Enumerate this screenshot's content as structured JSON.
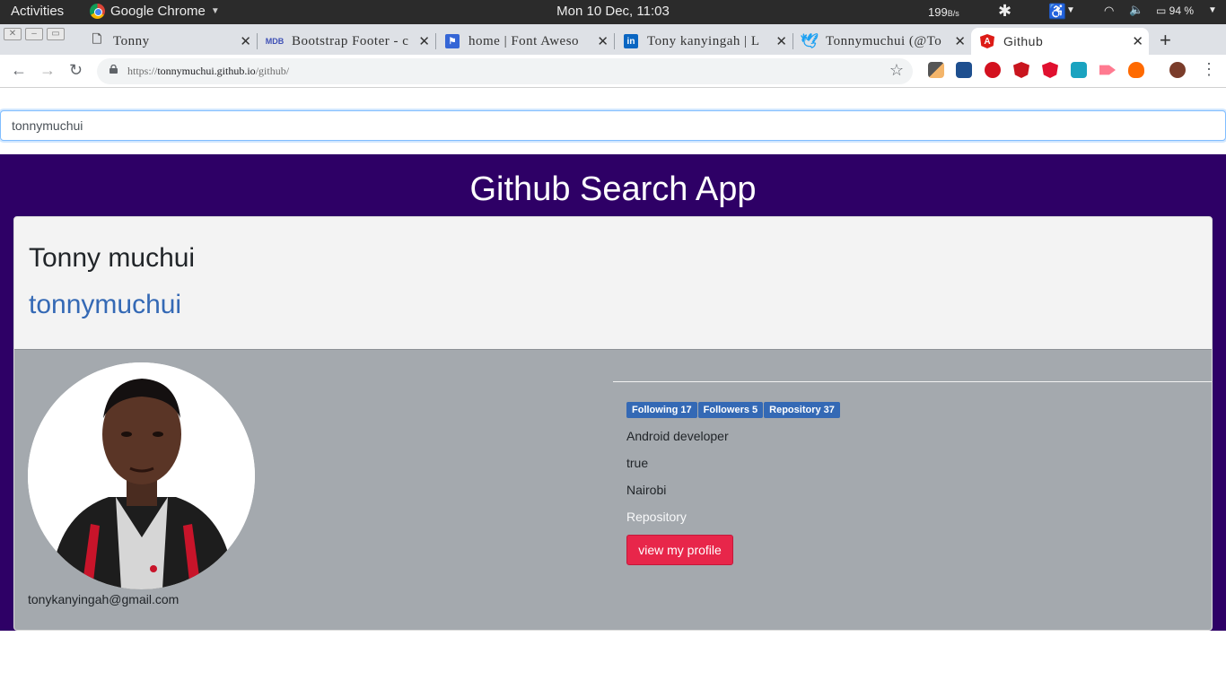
{
  "system_bar": {
    "activities": "Activities",
    "app_name": "Google Chrome",
    "clock": "Mon 10 Dec, 11:03",
    "net_speed": "199",
    "net_unit": "B/s",
    "battery": "94 %"
  },
  "tabs": [
    {
      "title": "Tonny",
      "icon": "page-icon"
    },
    {
      "title": "Bootstrap Footer - c",
      "icon": "mdb-icon"
    },
    {
      "title": "home | Font Aweso",
      "icon": "flag-icon"
    },
    {
      "title": "Tony kanyingah | L",
      "icon": "linkedin-icon"
    },
    {
      "title": "Tonnymuchui (@To",
      "icon": "twitter-icon"
    },
    {
      "title": "Github",
      "icon": "angular-icon",
      "active": true
    }
  ],
  "address_bar": {
    "url_scheme": "https://",
    "url_host": "tonnymuchui.github.io",
    "url_path": "/github/"
  },
  "search": {
    "value": "tonnymuchui"
  },
  "page": {
    "heading": "Github Search App"
  },
  "profile": {
    "name": "Tonny muchui",
    "login": "tonnymuchui",
    "email": "tonykanyingah@gmail.com",
    "following": "Following 17",
    "followers": "Followers 5",
    "repository_count": "Repository 37",
    "bio": "Android developer",
    "hireable": "true",
    "location": "Nairobi",
    "repository_link": "Repository",
    "profile_button": "view my profile"
  },
  "colors": {
    "hero_bg": "#2e0066",
    "card_body_bg": "#a4a9ae",
    "badge_bg": "#3469b5",
    "button_bg": "#e8264a",
    "link": "#3469b5"
  }
}
